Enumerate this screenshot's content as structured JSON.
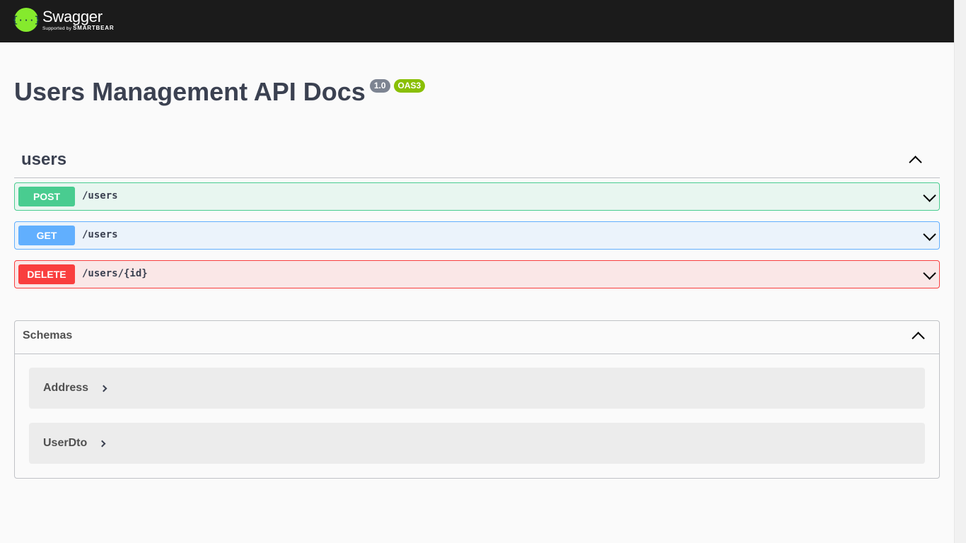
{
  "topbar": {
    "logo_glyph": "{···}",
    "logo_name": "Swagger",
    "logo_sub_prefix": "Supported by",
    "logo_sub_brand": "SMARTBEAR"
  },
  "info": {
    "title": "Users Management API Docs",
    "version": "1.0",
    "oas": "OAS3"
  },
  "tag": {
    "name": "users"
  },
  "operations": [
    {
      "method": "POST",
      "path": "/users",
      "color": "#49cc90"
    },
    {
      "method": "GET",
      "path": "/users",
      "color": "#61affe"
    },
    {
      "method": "DELETE",
      "path": "/users/{id}",
      "color": "#f93e3e"
    }
  ],
  "schemas": {
    "title": "Schemas",
    "models": [
      {
        "name": "Address"
      },
      {
        "name": "UserDto"
      }
    ]
  }
}
